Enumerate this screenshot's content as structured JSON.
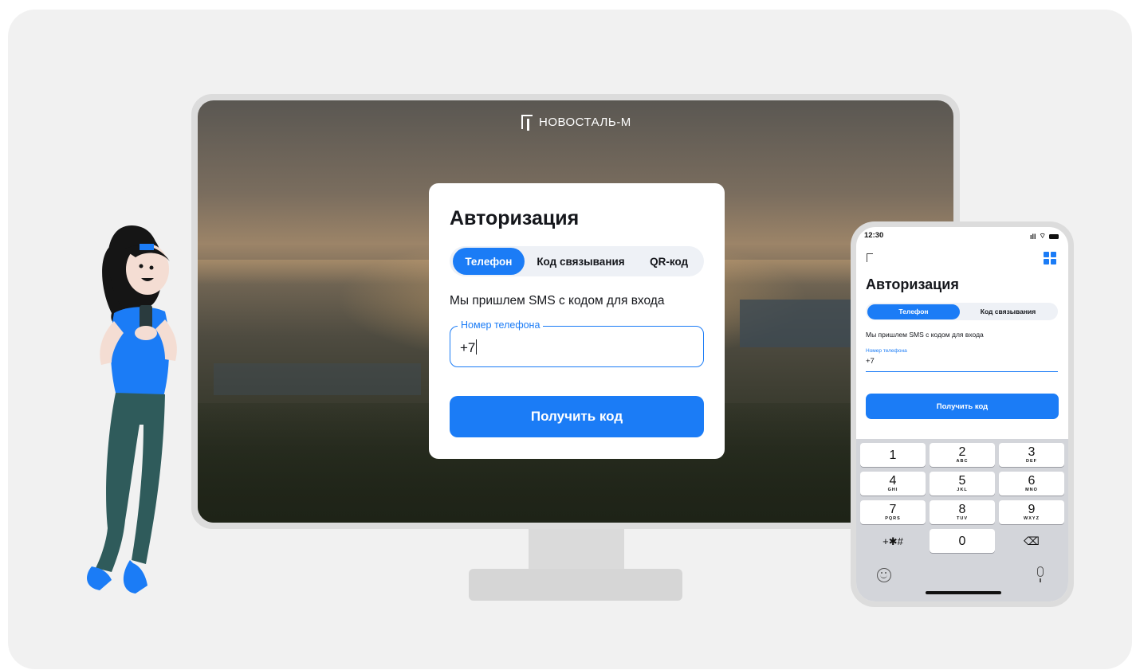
{
  "brand": {
    "name": "НОВОСТАЛЬ-М"
  },
  "desktop": {
    "title": "Авторизация",
    "tabs": [
      {
        "label": "Телефон",
        "active": true
      },
      {
        "label": "Код связывания",
        "active": false
      },
      {
        "label": "QR-код",
        "active": false
      }
    ],
    "hint": "Мы пришлем SMS с кодом для входа",
    "phone_field": {
      "label": "Номер телефона",
      "value": "+7"
    },
    "submit_label": "Получить код"
  },
  "mobile": {
    "status_time": "12:30",
    "title": "Авторизация",
    "tabs": [
      {
        "label": "Телефон",
        "active": true
      },
      {
        "label": "Код связывания",
        "active": false
      }
    ],
    "hint": "Мы пришлем SMS с кодом для входа",
    "phone_field": {
      "label": "Номер телефона",
      "value": "+7"
    },
    "submit_label": "Получить код",
    "keypad": [
      {
        "digit": "1",
        "letters": ""
      },
      {
        "digit": "2",
        "letters": "ABC"
      },
      {
        "digit": "3",
        "letters": "DEF"
      },
      {
        "digit": "4",
        "letters": "GHI"
      },
      {
        "digit": "5",
        "letters": "JKL"
      },
      {
        "digit": "6",
        "letters": "MNO"
      },
      {
        "digit": "7",
        "letters": "PQRS"
      },
      {
        "digit": "8",
        "letters": "TUV"
      },
      {
        "digit": "9",
        "letters": "WXYZ"
      },
      {
        "digit": "+✱#",
        "letters": ""
      },
      {
        "digit": "0",
        "letters": ""
      },
      {
        "digit": "⌫",
        "letters": ""
      }
    ]
  },
  "colors": {
    "accent": "#1b7cf6",
    "text": "#15171c",
    "background": "#f1f1f1"
  },
  "icons": [
    "brand-logo-icon",
    "qr-code-icon",
    "signal-icon",
    "wifi-icon",
    "battery-icon",
    "emoji-icon",
    "microphone-icon",
    "backspace-icon"
  ]
}
